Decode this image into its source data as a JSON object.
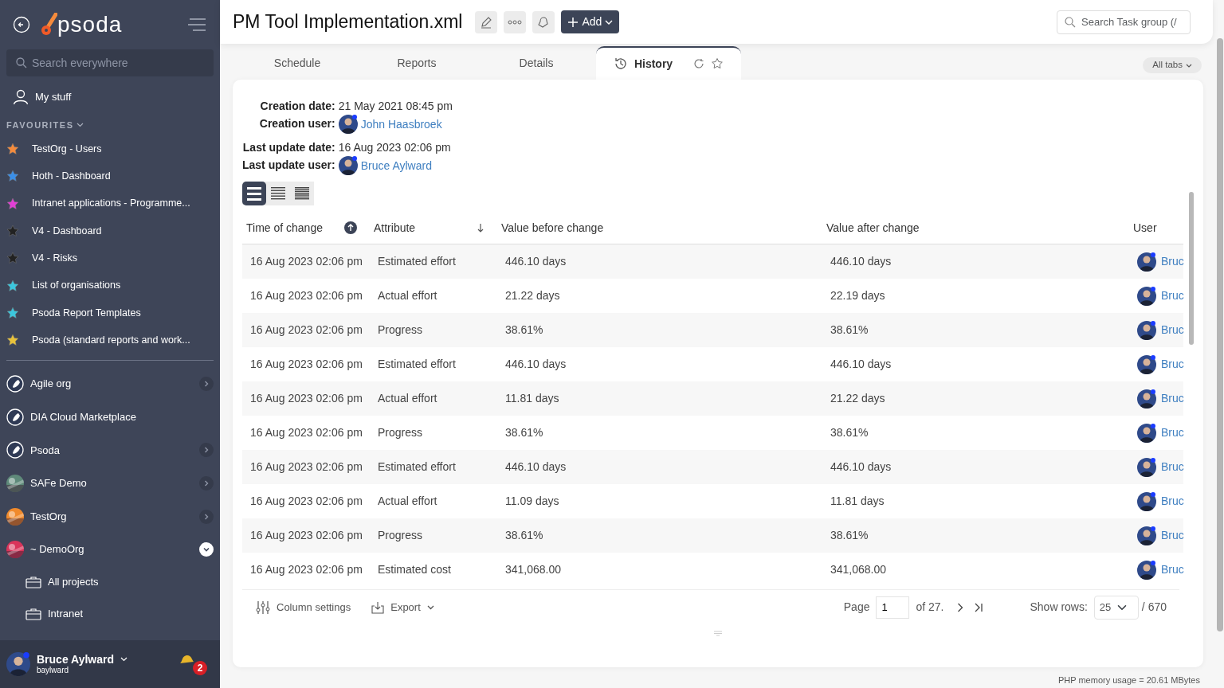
{
  "sidebar": {
    "logo": "psoda",
    "search": {
      "placeholder": "Search everywhere"
    },
    "my_stuff": "My stuff",
    "favourites_label": "FAVOURITES",
    "favourites": [
      {
        "label": "TestOrg - Users",
        "color": "#f58b3c"
      },
      {
        "label": "Hoth - Dashboard",
        "color": "#3b8fe8"
      },
      {
        "label": "Intranet applications - Programme...",
        "color": "#e23fd6"
      },
      {
        "label": "V4 - Dashboard",
        "color": "#222222"
      },
      {
        "label": "V4 - Risks",
        "color": "#222222"
      },
      {
        "label": "List of organisations",
        "color": "#3cc6dd"
      },
      {
        "label": "Psoda Report Templates",
        "color": "#3cc6dd"
      },
      {
        "label": "Psoda (standard reports and work...",
        "color": "#e8c23a"
      }
    ],
    "orgs": [
      {
        "label": "Agile org",
        "kind": "rocket",
        "expanded": false
      },
      {
        "label": "DIA Cloud Marketplace",
        "kind": "rocket"
      },
      {
        "label": "Psoda",
        "kind": "rocket",
        "expanded": false
      },
      {
        "label": "SAFe Demo",
        "kind": "picture",
        "color": "#5f8a7a",
        "expanded": false
      },
      {
        "label": "TestOrg",
        "kind": "picture",
        "color": "#f08a2c",
        "expanded": false
      },
      {
        "label": "~ DemoOrg",
        "kind": "picture",
        "color": "#d8345a",
        "expanded": true,
        "children": [
          {
            "label": "All projects"
          },
          {
            "label": "Intranet"
          }
        ]
      }
    ],
    "user": {
      "name": "Bruce Aylward",
      "username": "baylward",
      "notifications": "2"
    }
  },
  "header": {
    "title": "PM Tool Implementation.xml",
    "add_label": "Add",
    "search": {
      "placeholder": "Search Task group (/"
    }
  },
  "tabs": [
    {
      "label": "Schedule",
      "selected": false
    },
    {
      "label": "Reports",
      "selected": false
    },
    {
      "label": "Details",
      "selected": false
    },
    {
      "label": "History",
      "selected": true
    }
  ],
  "all_tabs": "All tabs",
  "details": [
    {
      "label": "Creation date:",
      "value": "21 May 2021 08:45 pm"
    },
    {
      "label": "Creation user:",
      "user": "John Haasbroek"
    },
    {
      "label": "Last update date:",
      "value": "16 Aug 2023 02:06 pm"
    },
    {
      "label": "Last update user:",
      "user": "Bruce Aylward"
    }
  ],
  "density": [
    {
      "kind": "large",
      "selected": true
    },
    {
      "kind": "medium",
      "selected": false
    },
    {
      "kind": "small",
      "selected": false
    }
  ],
  "table": {
    "columns": [
      {
        "label": "Time of change",
        "sorted": true
      },
      {
        "label": "Attribute",
        "sorted": false
      },
      {
        "label": "Value before change"
      },
      {
        "label": "Value after change"
      },
      {
        "label": "User"
      }
    ],
    "rows": [
      [
        "16 Aug 2023 02:06 pm",
        "Estimated effort",
        "446.10 days",
        "446.10 days",
        "Bruc"
      ],
      [
        "16 Aug 2023 02:06 pm",
        "Actual effort",
        "21.22 days",
        "22.19 days",
        "Bruc"
      ],
      [
        "16 Aug 2023 02:06 pm",
        "Progress",
        "38.61%",
        "38.61%",
        "Bruc"
      ],
      [
        "16 Aug 2023 02:06 pm",
        "Estimated effort",
        "446.10 days",
        "446.10 days",
        "Bruc"
      ],
      [
        "16 Aug 2023 02:06 pm",
        "Actual effort",
        "11.81 days",
        "21.22 days",
        "Bruc"
      ],
      [
        "16 Aug 2023 02:06 pm",
        "Progress",
        "38.61%",
        "38.61%",
        "Bruc"
      ],
      [
        "16 Aug 2023 02:06 pm",
        "Estimated effort",
        "446.10 days",
        "446.10 days",
        "Bruc"
      ],
      [
        "16 Aug 2023 02:06 pm",
        "Actual effort",
        "11.09 days",
        "11.81 days",
        "Bruc"
      ],
      [
        "16 Aug 2023 02:06 pm",
        "Progress",
        "38.61%",
        "38.61%",
        "Bruc"
      ],
      [
        "16 Aug 2023 02:06 pm",
        "Estimated cost",
        "341,068.00",
        "341,068.00",
        "Bruc"
      ]
    ]
  },
  "footer": {
    "column_settings": "Column settings",
    "export": "Export",
    "page_label": "Page",
    "page": "1",
    "of_pages": "of 27.",
    "show_rows_label": "Show rows:",
    "rows_per_page": "25",
    "total": "/ 670"
  },
  "memory": "PHP memory usage = 20.61 MBytes"
}
